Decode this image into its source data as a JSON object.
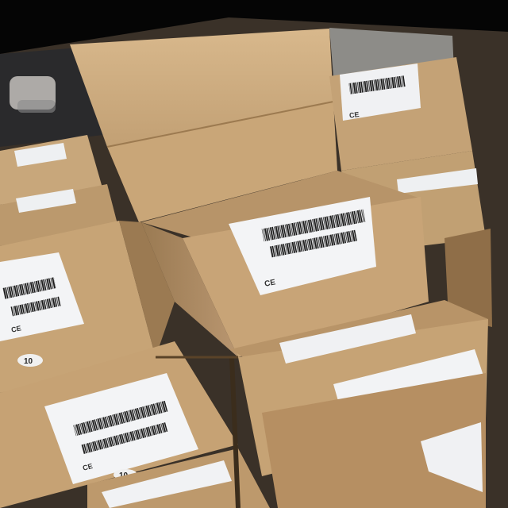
{
  "photo": {
    "labels": {
      "number_tag_left": "10",
      "number_tag_bottom": "10",
      "ce_mark_center": "CE",
      "ce_mark_left": "CE",
      "ce_mark_bottom": "CE",
      "ce_mark_top": "CE"
    },
    "colors": {
      "background": "#050505",
      "cardboard_light": "#cfae83",
      "cardboard_mid": "#b8946a",
      "cardboard_dark": "#8a6a45",
      "label_white": "#f2f3f5",
      "barcode": "#1a1a1a"
    }
  }
}
